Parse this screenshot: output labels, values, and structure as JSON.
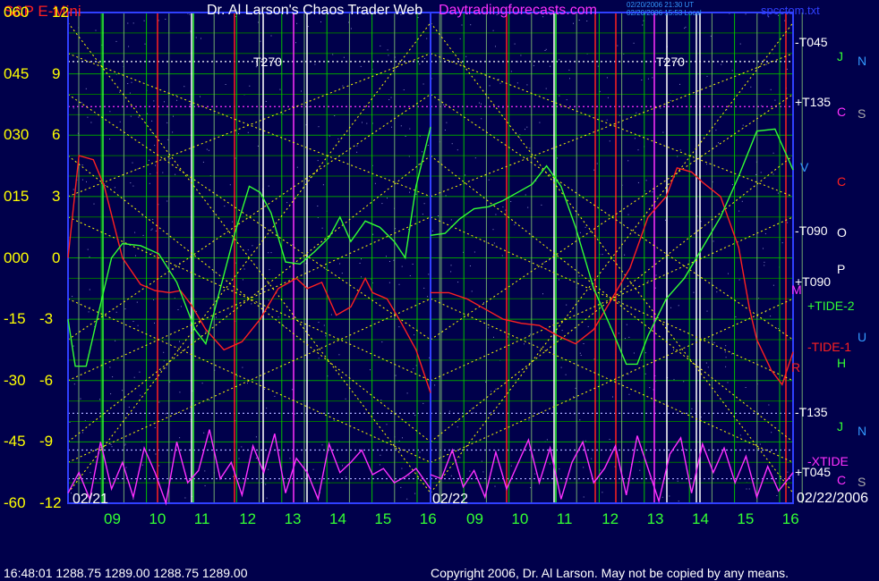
{
  "header": {
    "symbol": "S&P E-Mini",
    "title": "Dr. Al Larson's Chaos Trader Web",
    "site": "Daytradingforecasts.com",
    "stamp1": "02/20/2006 21:30 UT",
    "stamp2": "02/20/2006 15:53 Local",
    "file": "spcctom.txt"
  },
  "footer": {
    "quote": "16:48:01  1288.75  1289.00  1288.75  1289.00",
    "copyright": "Copyright 2006, Dr. Al Larson. May not be copied by any means."
  },
  "colors": {
    "background": "#00004b",
    "grid_h": "#00a000",
    "grid_v": "#00c000",
    "yellow": "#ffff00",
    "red": "#ff2020",
    "green": "#33ff33",
    "magenta": "#ff30ff",
    "blue_frame": "#3040ff",
    "cyan_label": "#3399ff"
  },
  "chart_data": {
    "type": "line",
    "title": "S&P E-Mini",
    "left_axis_outer": [
      "060",
      "045",
      "030",
      "015",
      "000",
      "-15",
      "-30",
      "-45",
      "-60"
    ],
    "left_axis_inner": [
      "12",
      "9",
      "6",
      "3",
      "0",
      "-3",
      "-6",
      "-9",
      "-12"
    ],
    "ylim": [
      -12,
      12
    ],
    "x_hour_labels": [
      "09",
      "10",
      "11",
      "12",
      "13",
      "14",
      "15",
      "16",
      "09",
      "10",
      "11",
      "12",
      "13",
      "14",
      "15",
      "16"
    ],
    "panels": [
      "02/21",
      "02/22"
    ],
    "bottom_right_date": "02/22/2006",
    "top_labels": [
      "T270",
      "T270"
    ],
    "right_labels": [
      {
        "text": "-T045",
        "y": 10.5,
        "color": "#ffffff"
      },
      {
        "text": "J",
        "y": 9.8,
        "color": "#33ff33"
      },
      {
        "text": "N",
        "y": 9.6,
        "color": "#3399ff"
      },
      {
        "text": "+T135",
        "y": 7.6,
        "color": "#ffffff"
      },
      {
        "text": "C",
        "y": 7.1,
        "color": "#ff30ff"
      },
      {
        "text": "S",
        "y": 7.0,
        "color": "#aaaaaa"
      },
      {
        "text": "V",
        "y": 4.4,
        "color": "#3399ff"
      },
      {
        "text": "C",
        "y": 3.7,
        "color": "#ff2020"
      },
      {
        "text": "-T090",
        "y": 1.3,
        "color": "#ffffff"
      },
      {
        "text": "O",
        "y": 1.2,
        "color": "#ffffff"
      },
      {
        "text": "P",
        "y": -0.6,
        "color": "#ffffff"
      },
      {
        "text": "+T090",
        "y": -1.2,
        "color": "#ffffff"
      },
      {
        "text": "M",
        "y": -1.6,
        "color": "#ff30ff"
      },
      {
        "text": "+TIDE-2",
        "y": -2.4,
        "color": "#33ff33"
      },
      {
        "text": "U",
        "y": -3.9,
        "color": "#3399ff"
      },
      {
        "text": "-TIDE-1",
        "y": -4.4,
        "color": "#ff2020"
      },
      {
        "text": "H",
        "y": -5.2,
        "color": "#33ff33"
      },
      {
        "text": "R",
        "y": -5.4,
        "color": "#ff2020"
      },
      {
        "text": "-T135",
        "y": -7.6,
        "color": "#ffffff"
      },
      {
        "text": "J",
        "y": -8.3,
        "color": "#33ff33"
      },
      {
        "text": "N",
        "y": -8.5,
        "color": "#3399ff"
      },
      {
        "text": "-XTIDE",
        "y": -10.0,
        "color": "#ff30ff"
      },
      {
        "text": "+T045",
        "y": -10.5,
        "color": "#ffffff"
      },
      {
        "text": "C",
        "y": -10.9,
        "color": "#ff30ff"
      },
      {
        "text": "S",
        "y": -11.0,
        "color": "#aaaaaa"
      }
    ],
    "series": [
      {
        "key": "red",
        "points": [
          [
            0,
            0
          ],
          [
            0.03,
            5.0
          ],
          [
            0.07,
            4.8
          ],
          [
            0.1,
            3.5
          ],
          [
            0.15,
            0
          ],
          [
            0.2,
            -1.3
          ],
          [
            0.24,
            -1.6
          ],
          [
            0.28,
            -1.7
          ],
          [
            0.31,
            -1.6
          ],
          [
            0.34,
            -2.3
          ],
          [
            0.38,
            -3.5
          ],
          [
            0.43,
            -4.5
          ],
          [
            0.48,
            -4.1
          ],
          [
            0.53,
            -3.0
          ],
          [
            0.58,
            -1.5
          ],
          [
            0.63,
            -1.0
          ],
          [
            0.66,
            -1.5
          ],
          [
            0.7,
            -1.2
          ],
          [
            0.74,
            -2.8
          ],
          [
            0.78,
            -2.4
          ],
          [
            0.82,
            -1.0
          ],
          [
            0.84,
            -1.7
          ],
          [
            0.88,
            -2.0
          ],
          [
            0.92,
            -3.2
          ],
          [
            0.96,
            -4.5
          ],
          [
            1.0,
            -6.6
          ]
        ]
      },
      {
        "key": "red",
        "points": [
          [
            0,
            -1.7
          ],
          [
            0.05,
            -1.7
          ],
          [
            0.1,
            -2.0
          ],
          [
            0.15,
            -2.5
          ],
          [
            0.2,
            -3.0
          ],
          [
            0.25,
            -3.2
          ],
          [
            0.3,
            -3.3
          ],
          [
            0.35,
            -3.8
          ],
          [
            0.4,
            -4.2
          ],
          [
            0.45,
            -3.5
          ],
          [
            0.5,
            -2.0
          ],
          [
            0.55,
            -0.5
          ],
          [
            0.6,
            2.0
          ],
          [
            0.65,
            3.0
          ],
          [
            0.68,
            4.4
          ],
          [
            0.72,
            4.2
          ],
          [
            0.75,
            3.7
          ],
          [
            0.8,
            3.0
          ],
          [
            0.85,
            0.5
          ],
          [
            0.88,
            -2.5
          ],
          [
            0.9,
            -4.0
          ],
          [
            0.94,
            -5.5
          ],
          [
            0.97,
            -6.2
          ],
          [
            1.0,
            -4.6
          ]
        ]
      },
      {
        "key": "green",
        "points": [
          [
            0,
            -3.0
          ],
          [
            0.02,
            -5.3
          ],
          [
            0.05,
            -5.3
          ],
          [
            0.08,
            -3.0
          ],
          [
            0.12,
            0
          ],
          [
            0.15,
            0.7
          ],
          [
            0.2,
            0.6
          ],
          [
            0.25,
            0.2
          ],
          [
            0.3,
            -1.2
          ],
          [
            0.35,
            -3.5
          ],
          [
            0.38,
            -4.2
          ],
          [
            0.42,
            -1.5
          ],
          [
            0.46,
            1.2
          ],
          [
            0.5,
            3.5
          ],
          [
            0.53,
            3.2
          ],
          [
            0.56,
            2.2
          ],
          [
            0.6,
            -0.2
          ],
          [
            0.64,
            -0.3
          ],
          [
            0.68,
            0.3
          ],
          [
            0.72,
            1.0
          ],
          [
            0.75,
            2.0
          ],
          [
            0.78,
            0.8
          ],
          [
            0.82,
            1.8
          ],
          [
            0.86,
            1.5
          ],
          [
            0.9,
            0.8
          ],
          [
            0.93,
            0
          ],
          [
            0.96,
            3.5
          ],
          [
            1.0,
            6.4
          ]
        ]
      },
      {
        "key": "green",
        "points": [
          [
            0,
            1.1
          ],
          [
            0.04,
            1.2
          ],
          [
            0.08,
            1.9
          ],
          [
            0.12,
            2.4
          ],
          [
            0.16,
            2.5
          ],
          [
            0.2,
            2.8
          ],
          [
            0.24,
            3.2
          ],
          [
            0.28,
            3.6
          ],
          [
            0.32,
            4.5
          ],
          [
            0.36,
            3.5
          ],
          [
            0.4,
            1.5
          ],
          [
            0.45,
            -1.5
          ],
          [
            0.5,
            -3.5
          ],
          [
            0.54,
            -5.2
          ],
          [
            0.57,
            -5.2
          ],
          [
            0.6,
            -3.8
          ],
          [
            0.65,
            -2.0
          ],
          [
            0.7,
            -1.0
          ],
          [
            0.75,
            0.5
          ],
          [
            0.8,
            2.0
          ],
          [
            0.85,
            4.0
          ],
          [
            0.9,
            6.2
          ],
          [
            0.95,
            6.3
          ],
          [
            1.0,
            4.3
          ]
        ]
      },
      {
        "key": "magenta",
        "points": [
          [
            0,
            -11.5
          ],
          [
            0.03,
            -10.5
          ],
          [
            0.06,
            -11.8
          ],
          [
            0.09,
            -9.0
          ],
          [
            0.12,
            -11.3
          ],
          [
            0.15,
            -10.0
          ],
          [
            0.18,
            -11.7
          ],
          [
            0.21,
            -9.3
          ],
          [
            0.24,
            -10.5
          ],
          [
            0.27,
            -12.0
          ],
          [
            0.3,
            -9.0
          ],
          [
            0.33,
            -11.0
          ],
          [
            0.36,
            -10.4
          ],
          [
            0.39,
            -8.4
          ],
          [
            0.42,
            -10.8
          ],
          [
            0.45,
            -10.0
          ],
          [
            0.48,
            -11.6
          ],
          [
            0.51,
            -9.2
          ],
          [
            0.54,
            -10.5
          ],
          [
            0.57,
            -8.6
          ],
          [
            0.6,
            -11.5
          ],
          [
            0.63,
            -9.8
          ],
          [
            0.66,
            -10.5
          ],
          [
            0.69,
            -11.8
          ],
          [
            0.72,
            -9.1
          ],
          [
            0.75,
            -10.5
          ],
          [
            0.78,
            -10.0
          ],
          [
            0.81,
            -9.4
          ],
          [
            0.84,
            -10.6
          ],
          [
            0.87,
            -10.3
          ],
          [
            0.9,
            -11.0
          ],
          [
            0.93,
            -10.7
          ],
          [
            0.96,
            -10.3
          ],
          [
            1.0,
            -11.3
          ]
        ]
      },
      {
        "key": "magenta",
        "points": [
          [
            0,
            -10.6
          ],
          [
            0.03,
            -10.8
          ],
          [
            0.06,
            -9.4
          ],
          [
            0.09,
            -11.2
          ],
          [
            0.12,
            -10.4
          ],
          [
            0.15,
            -11.7
          ],
          [
            0.18,
            -9.5
          ],
          [
            0.21,
            -11.3
          ],
          [
            0.24,
            -10.1
          ],
          [
            0.27,
            -8.9
          ],
          [
            0.3,
            -11.0
          ],
          [
            0.33,
            -9.3
          ],
          [
            0.36,
            -11.8
          ],
          [
            0.39,
            -10.0
          ],
          [
            0.42,
            -9.0
          ],
          [
            0.45,
            -11.0
          ],
          [
            0.48,
            -10.3
          ],
          [
            0.51,
            -9.2
          ],
          [
            0.54,
            -11.6
          ],
          [
            0.57,
            -8.7
          ],
          [
            0.6,
            -10.3
          ],
          [
            0.63,
            -11.9
          ],
          [
            0.66,
            -9.6
          ],
          [
            0.69,
            -8.8
          ],
          [
            0.72,
            -11.5
          ],
          [
            0.75,
            -9.1
          ],
          [
            0.78,
            -10.5
          ],
          [
            0.81,
            -9.3
          ],
          [
            0.84,
            -11.0
          ],
          [
            0.87,
            -9.7
          ],
          [
            0.9,
            -11.7
          ],
          [
            0.93,
            -10.2
          ],
          [
            0.96,
            -11.4
          ],
          [
            1.0,
            -10.5
          ]
        ]
      }
    ]
  }
}
